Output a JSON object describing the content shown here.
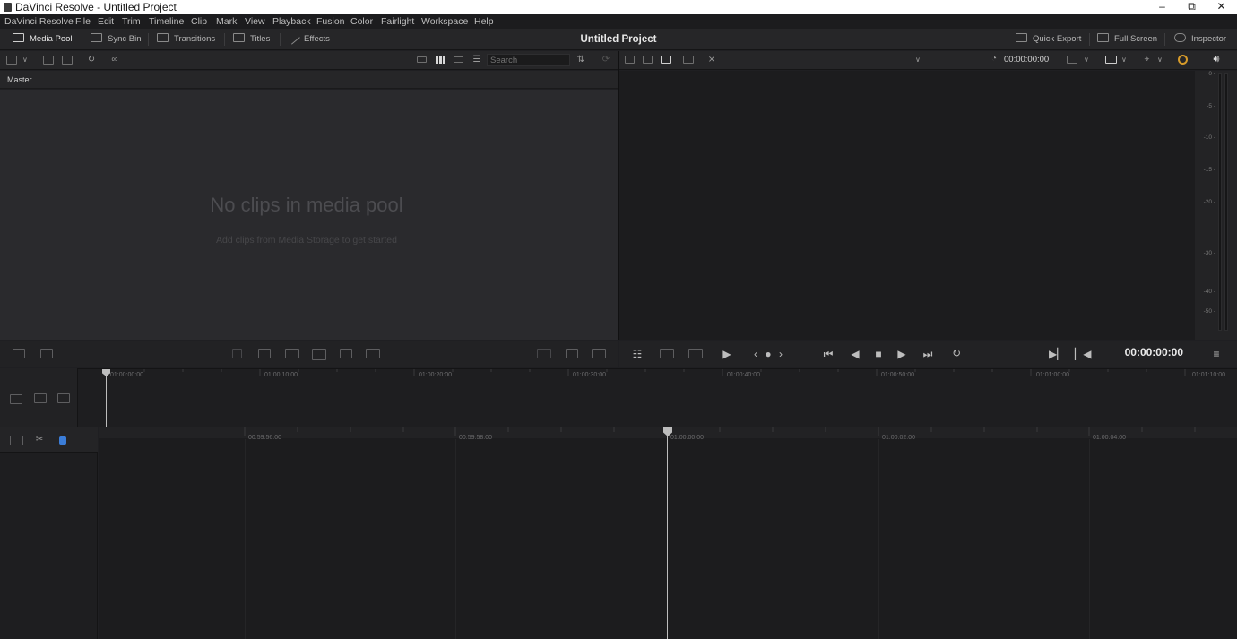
{
  "window": {
    "title": "DaVinci Resolve - Untitled Project",
    "minimize_glyph": "–",
    "maximize_glyph": "⧉",
    "close_glyph": "✕"
  },
  "menu": [
    "DaVinci Resolve",
    "File",
    "Edit",
    "Trim",
    "Timeline",
    "Clip",
    "Mark",
    "View",
    "Playback",
    "Fusion",
    "Color",
    "Fairlight",
    "Workspace",
    "Help"
  ],
  "toolbar": {
    "media_pool": "Media Pool",
    "sync_bin": "Sync Bin",
    "transitions": "Transitions",
    "titles": "Titles",
    "effects": "Effects",
    "project_title": "Untitled Project",
    "quick_export": "Quick Export",
    "full_screen": "Full Screen",
    "inspector": "Inspector"
  },
  "media_pool": {
    "search_placeholder": "Search",
    "bin_name": "Master",
    "empty_title": "No clips in media pool",
    "empty_subtitle": "Add clips from Media Storage to get started"
  },
  "viewer": {
    "source_timecode": "00:00:00:00",
    "main_timecode": "00:00:00:00"
  },
  "audio_meter": {
    "ticks": [
      "0 -",
      "-5 -",
      "-10 -",
      "-15 -",
      "-20 -",
      "-30 -",
      "-40 -",
      "-50 -"
    ]
  },
  "upper_timeline": {
    "ruler": [
      "01:00:00:00",
      "01:00:10:00",
      "01:00:20:00",
      "01:00:30:00",
      "01:00:40:00",
      "01:00:50:00",
      "01:01:00:00",
      "01:01:10:00"
    ]
  },
  "lower_timeline": {
    "ruler": [
      "00:59:56:00",
      "00:59:58:00",
      "01:00:00:00",
      "01:00:02:00",
      "01:00:04:00"
    ]
  },
  "colors": {
    "accent_blue": "#3b7dd8",
    "background": "#1f1f22",
    "panel": "#2a2a2d"
  }
}
